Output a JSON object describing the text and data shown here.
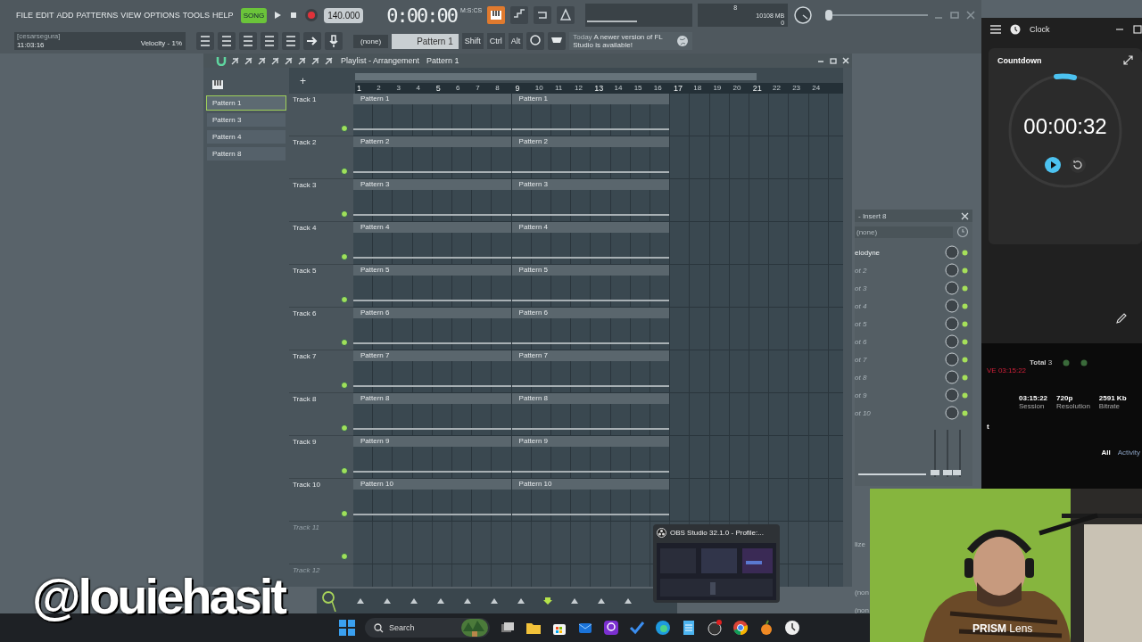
{
  "fl": {
    "menu": [
      "FILE",
      "EDIT",
      "ADD",
      "PATTERNS",
      "VIEW",
      "OPTIONS",
      "TOOLS",
      "HELP"
    ],
    "song_mode": "SONG",
    "tempo": "140.000",
    "time": "0:00:00",
    "pitch": {
      "level": 0
    },
    "time_unit": "M:S:CS",
    "cpu": "8",
    "memory": "10108 MB",
    "polyphony": "0",
    "hint": {
      "user": "[cesarsegura]",
      "time": "11:03:16",
      "velocity": "Velocity - 1%"
    },
    "preset": "(none)",
    "pattern": "Pattern 1",
    "modifier_keys": [
      "Shift",
      "Ctrl",
      "Alt"
    ],
    "news": {
      "date": "Today",
      "message": "A newer version of FL Studio is available!"
    }
  },
  "playlist": {
    "title": "Playlist - Arrangement",
    "pattern": "Pattern 1",
    "add_label": "+",
    "bars": [
      "1",
      "2",
      "3",
      "4",
      "5",
      "6",
      "7",
      "8",
      "9",
      "10",
      "11",
      "12",
      "13",
      "14",
      "15",
      "16",
      "17",
      "18",
      "19",
      "20",
      "21",
      "22",
      "23",
      "24"
    ],
    "patterns": [
      {
        "name": "Pattern 1",
        "selected": true
      },
      {
        "name": "Pattern 3",
        "selected": false
      },
      {
        "name": "Pattern 4",
        "selected": false
      },
      {
        "name": "Pattern 8",
        "selected": false
      }
    ],
    "tracks": [
      {
        "name": "Track 1",
        "disabled": false,
        "clips": [
          "Pattern 1",
          "Pattern 1"
        ]
      },
      {
        "name": "Track 2",
        "disabled": false,
        "clips": [
          "Pattern 2",
          "Pattern 2"
        ]
      },
      {
        "name": "Track 3",
        "disabled": false,
        "clips": [
          "Pattern 3",
          "Pattern 3"
        ]
      },
      {
        "name": "Track 4",
        "disabled": false,
        "clips": [
          "Pattern 4",
          "Pattern 4"
        ]
      },
      {
        "name": "Track 5",
        "disabled": false,
        "clips": [
          "Pattern 5",
          "Pattern 5"
        ]
      },
      {
        "name": "Track 6",
        "disabled": false,
        "clips": [
          "Pattern 6",
          "Pattern 6"
        ]
      },
      {
        "name": "Track 7",
        "disabled": false,
        "clips": [
          "Pattern 7",
          "Pattern 7"
        ]
      },
      {
        "name": "Track 8",
        "disabled": false,
        "clips": [
          "Pattern 8",
          "Pattern 8"
        ]
      },
      {
        "name": "Track 9",
        "disabled": false,
        "clips": [
          "Pattern 9",
          "Pattern 9"
        ]
      },
      {
        "name": "Track 10",
        "disabled": false,
        "clips": [
          "Pattern 10",
          "Pattern 10"
        ]
      },
      {
        "name": "Track 11",
        "disabled": true
      },
      {
        "name": "Track 12",
        "disabled": true
      }
    ]
  },
  "mixer": {
    "title": "- Insert 8",
    "preset": "(none)",
    "slots": [
      {
        "name": "elodyne",
        "active": true
      },
      {
        "name": "ot 2",
        "active": false
      },
      {
        "name": "ot 3",
        "active": false
      },
      {
        "name": "ot 4",
        "active": false
      },
      {
        "name": "ot 5",
        "active": false
      },
      {
        "name": "ot 6",
        "active": false
      },
      {
        "name": "ot 7",
        "active": false
      },
      {
        "name": "ot 8",
        "active": false
      },
      {
        "name": "ot 9",
        "active": false
      },
      {
        "name": "ot 10",
        "active": false
      }
    ],
    "fragments": [
      "lize",
      "(non",
      "(non"
    ]
  },
  "clock": {
    "app": "Clock",
    "section": "Countdown",
    "timer": "00:00:32"
  },
  "stream": {
    "total_label": "Total",
    "total": "3",
    "live": "VE 03:15:22",
    "stats": [
      {
        "value": "03:15:22",
        "label": "Session"
      },
      {
        "value": "720p",
        "label": "Resolution"
      },
      {
        "value": "2591 Kb",
        "label": "Bitrate"
      }
    ],
    "chat_title": "t",
    "filters": [
      {
        "label": "All",
        "selected": true
      },
      {
        "label": "Activity",
        "selected": false
      }
    ]
  },
  "obs_preview": {
    "title": "OBS Studio 32.1.0 - Profile:..."
  },
  "webcam": {
    "kind": "picture",
    "caption": "**PRISM** Lens"
  },
  "taskbar": {
    "search": "Search"
  },
  "overlay": {
    "handle": "@louiehasit"
  }
}
